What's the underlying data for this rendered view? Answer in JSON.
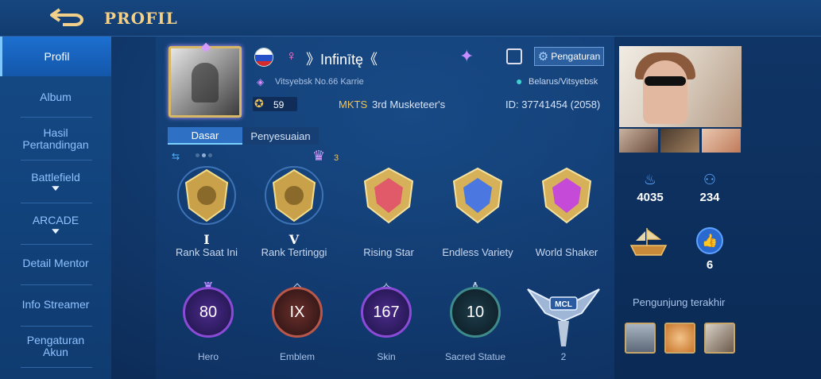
{
  "header": {
    "title": "PROFIL",
    "back_icon": "back-arrow-icon"
  },
  "sidebar": {
    "items": [
      {
        "label": "Profil",
        "active": true
      },
      {
        "label": "Album"
      },
      {
        "label": "Hasil Pertandingan"
      },
      {
        "label": "Battlefield",
        "expandable": true
      },
      {
        "label": "ARCADE",
        "expandable": true
      },
      {
        "label": "Detail Mentor"
      },
      {
        "label": "Info Streamer"
      },
      {
        "label": "Pengaturan Akun"
      }
    ]
  },
  "profile": {
    "gender_symbol": "♀",
    "username": "》Infinītę《",
    "title_line": "Vitsyebsk No.66 Karrie",
    "location": "Belarus/Vitsyebsk",
    "coins": "59",
    "squad_tag": "MKTS",
    "squad_name": "3rd Musketeer's",
    "id_line": "ID: 37741454 (2058)",
    "settings_label": "Pengaturan"
  },
  "tabs": [
    {
      "label": "Dasar",
      "active": true
    },
    {
      "label": "Penyesuaian"
    }
  ],
  "badge_count": "3",
  "medals": [
    {
      "label": "Rank Saat Ini",
      "roman": "I",
      "color": "#c9a14a"
    },
    {
      "label": "Rank Tertinggi",
      "roman": "V",
      "color": "#c9a14a"
    },
    {
      "label": "Rising Star",
      "color": "#e05a6a"
    },
    {
      "label": "Endless Variety",
      "color": "#4a78e0"
    },
    {
      "label": "World Shaker",
      "color": "#c54ad8"
    }
  ],
  "stats": [
    {
      "label": "Hero",
      "value": "80",
      "color": "#8a4bd6"
    },
    {
      "label": "Emblem",
      "value": "IX",
      "color": "#b8574a"
    },
    {
      "label": "Skin",
      "value": "167",
      "color": "#8a4bd6"
    },
    {
      "label": "Sacred Statue",
      "value": "10",
      "color": "#3f8a8a"
    }
  ],
  "mcl": {
    "label": "MCL",
    "count": "2"
  },
  "right": {
    "popularity": "4035",
    "followers": "234",
    "likes": "6",
    "visitors_label": "Pengunjung terakhir"
  }
}
